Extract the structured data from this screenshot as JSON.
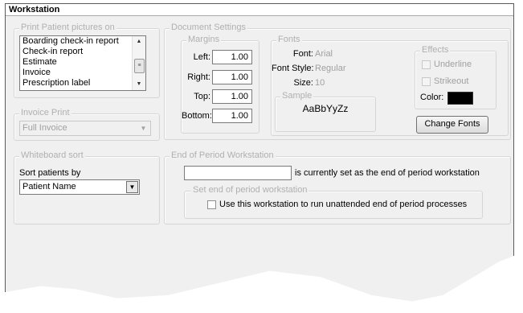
{
  "window": {
    "title": "Workstation"
  },
  "print_pictures": {
    "legend": "Print Patient pictures on",
    "items": [
      "Boarding check-in report",
      "Check-in report",
      "Estimate",
      "Invoice",
      "Prescription label"
    ]
  },
  "invoice_print": {
    "legend": "Invoice Print",
    "selected": "Full Invoice"
  },
  "whiteboard": {
    "legend": "Whiteboard sort",
    "sort_label": "Sort patients by",
    "selected": "Patient Name"
  },
  "document_settings": {
    "legend": "Document Settings",
    "margins": {
      "legend": "Margins",
      "left_label": "Left:",
      "left_value": "1.00",
      "right_label": "Right:",
      "right_value": "1.00",
      "top_label": "Top:",
      "top_value": "1.00",
      "bottom_label": "Bottom:",
      "bottom_value": "1.00"
    },
    "fonts": {
      "legend": "Fonts",
      "font_label": "Font:",
      "font_value": "Arial",
      "style_label": "Font Style:",
      "style_value": "Regular",
      "size_label": "Size:",
      "size_value": "10",
      "sample_legend": "Sample",
      "sample_text": "AaBbYyZz"
    },
    "effects": {
      "legend": "Effects",
      "underline": "Underline",
      "strikeout": "Strikeout",
      "color_label": "Color:",
      "color_value": "#000000"
    },
    "change_fonts_button": "Change Fonts"
  },
  "end_of_period": {
    "legend": "End of Period Workstation",
    "input_value": "",
    "note": "is currently set as the end of period workstation",
    "set_legend": "Set end of period workstation",
    "checkbox_label": "Use this workstation to run unattended end of period processes"
  }
}
